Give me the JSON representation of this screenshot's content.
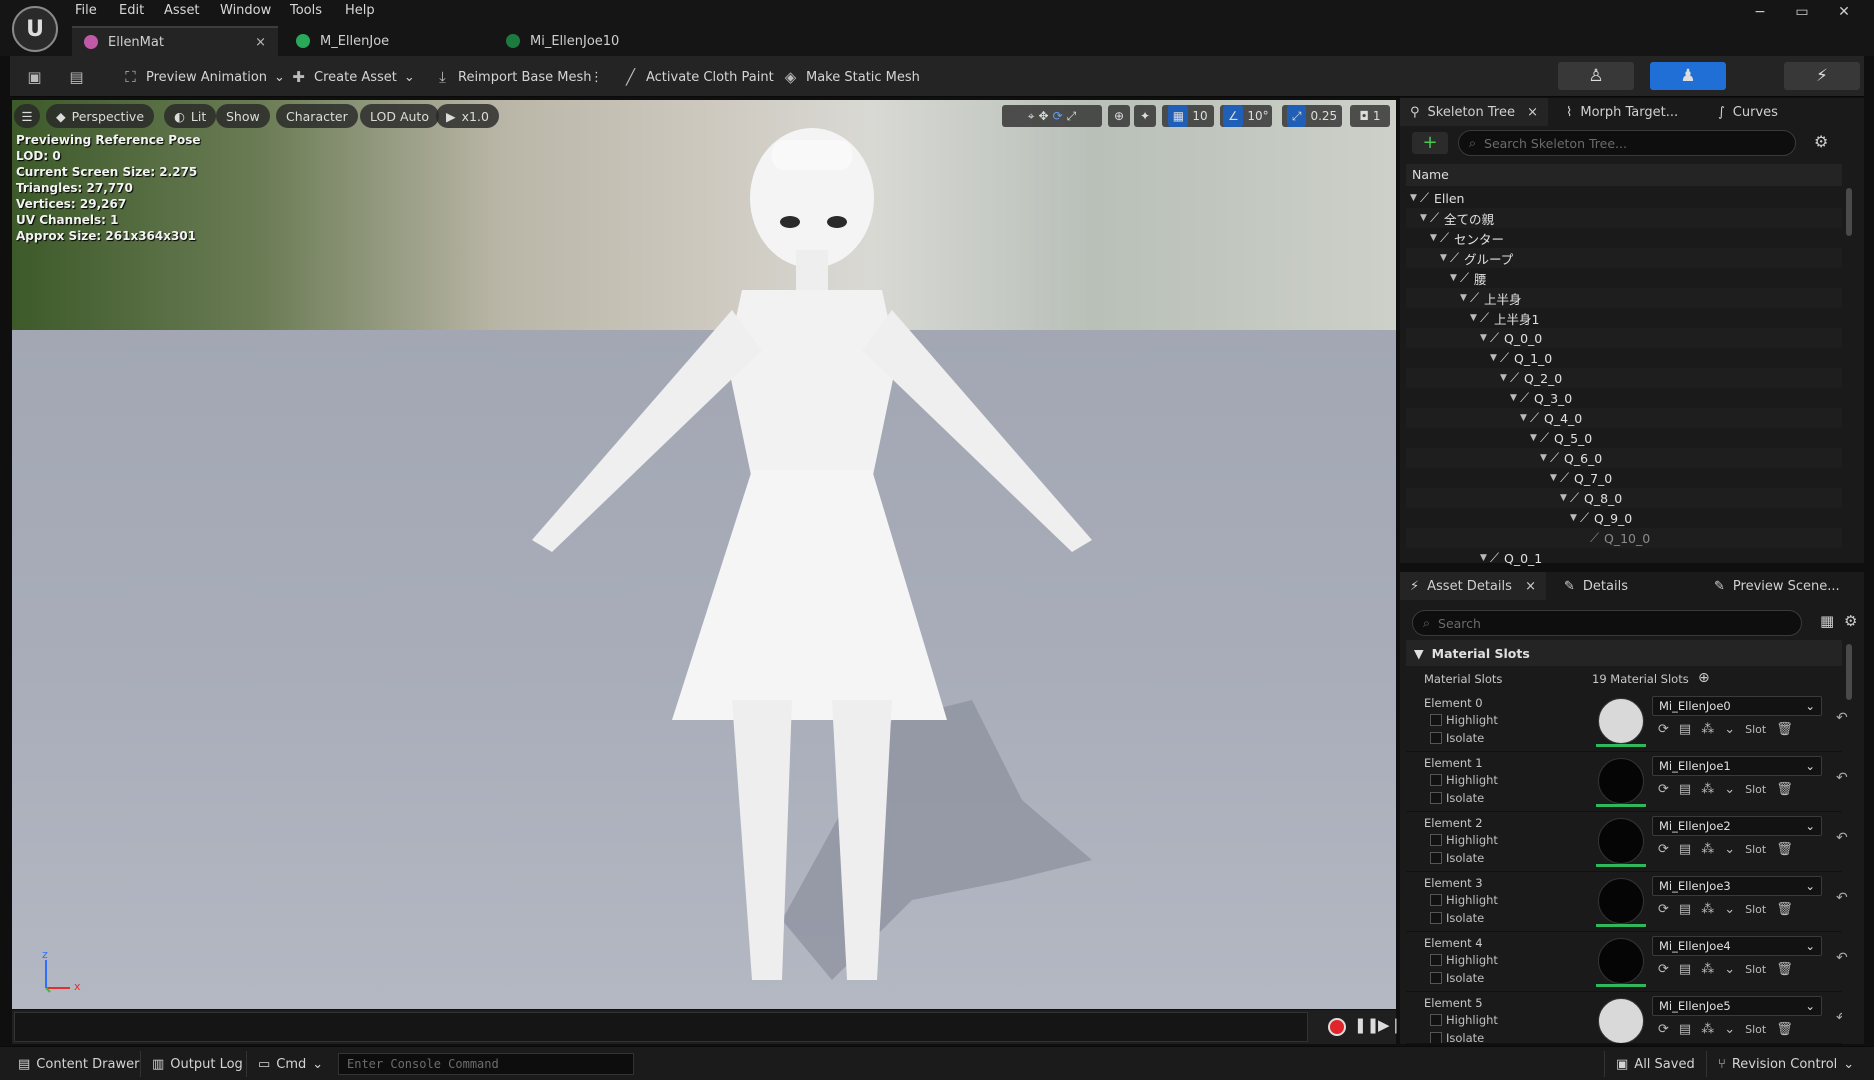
{
  "menu": [
    "File",
    "Edit",
    "Asset",
    "Window",
    "Tools",
    "Help"
  ],
  "doc_tabs": [
    {
      "label": "EllenMat",
      "close": "×"
    },
    {
      "label": "M_EllenJoe"
    },
    {
      "label": "Mi_EllenJoe10"
    }
  ],
  "window_controls": {
    "minimize": "−",
    "maximize": "▭",
    "close": "✕"
  },
  "toolbar": {
    "preview_animation": "Preview Animation",
    "create_asset": "Create Asset",
    "reimport": "Reimport Base Mesh",
    "activate_cloth": "Activate Cloth Paint",
    "make_static": "Make Static Mesh"
  },
  "viewport": {
    "view_mode": "Perspective",
    "lighting": "Lit",
    "show": "Show",
    "character": "Character",
    "lod": "LOD Auto",
    "speed": "x1.0",
    "grid_snap": "10",
    "rot_snap": "10°",
    "scale_snap": "0.25",
    "camera_speed": "1",
    "stats": [
      "Previewing Reference Pose",
      "LOD: 0",
      "Current Screen Size: 2.275",
      "Triangles: 27,770",
      "Vertices: 29,267",
      "UV Channels: 1",
      "Approx Size: 261x364x301"
    ],
    "axis_z": "z",
    "axis_x": "x"
  },
  "skeleton_panel": {
    "tabs": [
      {
        "label": "Skeleton Tree",
        "close": "×"
      },
      {
        "label": "Morph Target..."
      },
      {
        "label": "Curves"
      }
    ],
    "search_placeholder": "Search Skeleton Tree...",
    "column_header": "Name",
    "bones": [
      {
        "label": "Ellen"
      },
      {
        "label": "全ての親"
      },
      {
        "label": "センター"
      },
      {
        "label": "グループ"
      },
      {
        "label": "腰"
      },
      {
        "label": "上半身"
      },
      {
        "label": "上半身1"
      },
      {
        "label": "Q_0_0"
      },
      {
        "label": "Q_1_0"
      },
      {
        "label": "Q_2_0"
      },
      {
        "label": "Q_3_0"
      },
      {
        "label": "Q_4_0"
      },
      {
        "label": "Q_5_0"
      },
      {
        "label": "Q_6_0"
      },
      {
        "label": "Q_7_0"
      },
      {
        "label": "Q_8_0"
      },
      {
        "label": "Q_9_0"
      },
      {
        "label": "Q_10_0"
      },
      {
        "label": "Q_0_1"
      }
    ]
  },
  "details_panel": {
    "tabs": [
      {
        "label": "Asset Details",
        "close": "×"
      },
      {
        "label": "Details"
      },
      {
        "label": "Preview Scene..."
      }
    ],
    "search_placeholder": "Search",
    "section": "Material Slots",
    "slots_label": "Material Slots",
    "slots_count": "19 Material Slots",
    "highlight": "Highlight",
    "isolate": "Isolate",
    "slot": "Slot",
    "elements": [
      {
        "name": "Element 0",
        "material": "Mi_EllenJoe0",
        "thumb": "#d9d9d9"
      },
      {
        "name": "Element 1",
        "material": "Mi_EllenJoe1",
        "thumb": "#050505"
      },
      {
        "name": "Element 2",
        "material": "Mi_EllenJoe2",
        "thumb": "#050505"
      },
      {
        "name": "Element 3",
        "material": "Mi_EllenJoe3",
        "thumb": "#050505"
      },
      {
        "name": "Element 4",
        "material": "Mi_EllenJoe4",
        "thumb": "#050505"
      },
      {
        "name": "Element 5",
        "material": "Mi_EllenJoe5",
        "thumb": "#d9d9d9"
      }
    ]
  },
  "statusbar": {
    "content_drawer": "Content Drawer",
    "output_log": "Output Log",
    "cmd": "Cmd",
    "console_placeholder": "Enter Console Command",
    "all_saved": "All Saved",
    "revision": "Revision Control"
  },
  "colors": {
    "accent": "#1f6fd6",
    "highlight_green": "#2fb85b",
    "record": "#e0262a"
  }
}
